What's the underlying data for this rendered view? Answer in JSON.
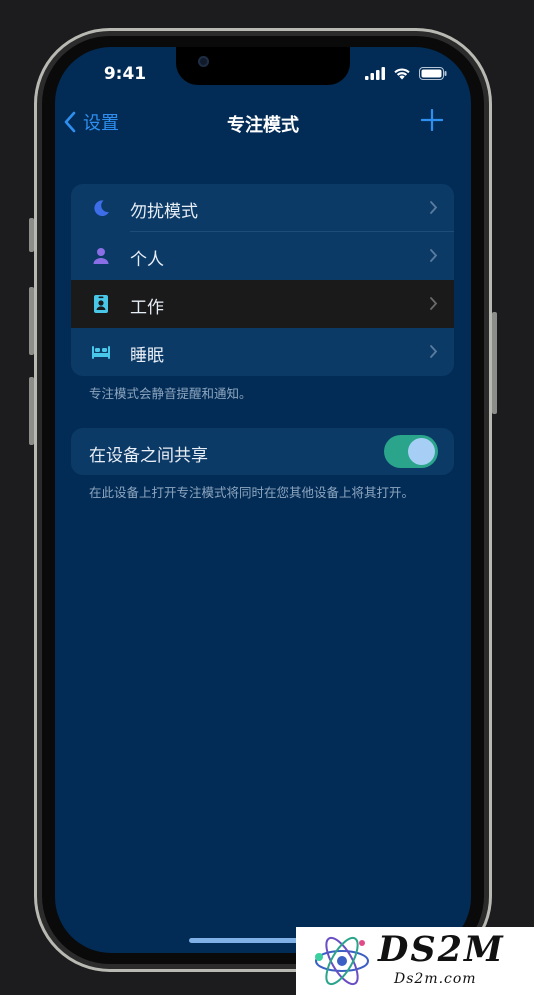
{
  "status_bar": {
    "time": "9:41"
  },
  "nav": {
    "back_label": "设置",
    "title": "专注模式"
  },
  "focus_modes": [
    {
      "label": "勿扰模式",
      "icon": "moon-icon",
      "color": "#3d6ee8"
    },
    {
      "label": "个人",
      "icon": "person-icon",
      "color": "#8a6ee6"
    },
    {
      "label": "工作",
      "icon": "id-badge-icon",
      "color": "#49c7e8"
    },
    {
      "label": "睡眠",
      "icon": "bed-icon",
      "color": "#49c7e8"
    }
  ],
  "focus_footnote": "专注模式会静音提醒和通知。",
  "share": {
    "label": "在设备之间共享",
    "enabled": true,
    "footnote": "在此设备上打开专注模式将同时在您其他设备上将其打开。"
  },
  "watermark": {
    "big": "DS2M",
    "small": "Ds2m.com"
  },
  "colors": {
    "accent": "#2e8ff0",
    "background": "#022c55",
    "toggle_on": "#2aa58c"
  }
}
